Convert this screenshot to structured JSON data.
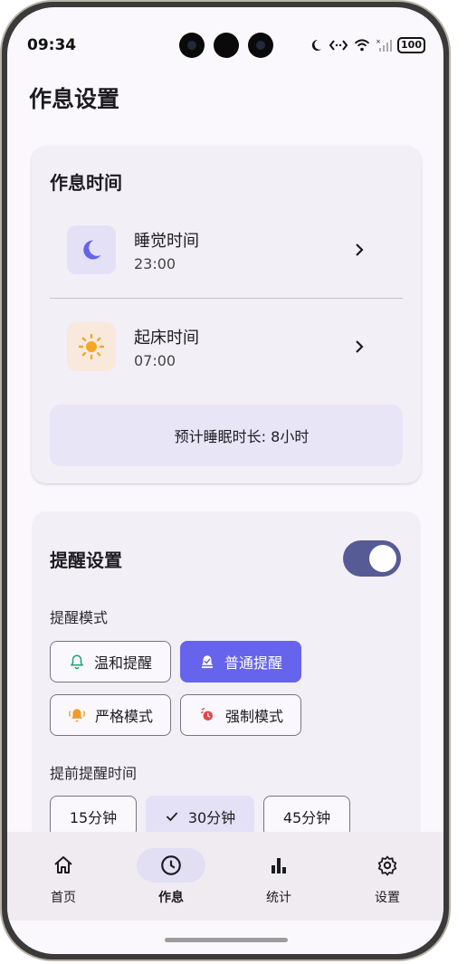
{
  "status_bar": {
    "time": "09:34",
    "battery": "100"
  },
  "page": {
    "title": "作息设置"
  },
  "schedule": {
    "title": "作息时间",
    "sleep": {
      "label": "睡觉时间",
      "value": "23:00"
    },
    "wake": {
      "label": "起床时间",
      "value": "07:00"
    },
    "summary": "预计睡眠时长: 8小时"
  },
  "reminder": {
    "title": "提醒设置",
    "enabled": true,
    "mode_label": "提醒模式",
    "modes": [
      {
        "label": "温和提醒",
        "selected": false
      },
      {
        "label": "普通提醒",
        "selected": true
      },
      {
        "label": "严格模式",
        "selected": false
      },
      {
        "label": "强制模式",
        "selected": false
      }
    ],
    "advance_label": "提前提醒时间",
    "advance_options": [
      {
        "label": "15分钟",
        "selected": false
      },
      {
        "label": "30分钟",
        "selected": true
      },
      {
        "label": "45分钟",
        "selected": false
      }
    ]
  },
  "nav": {
    "items": [
      {
        "label": "首页",
        "icon": "home-icon"
      },
      {
        "label": "作息",
        "icon": "clock-icon",
        "active": true
      },
      {
        "label": "统计",
        "icon": "bar-chart-icon"
      },
      {
        "label": "设置",
        "icon": "gear-icon"
      }
    ]
  },
  "colors": {
    "accent": "#6664ec",
    "toggle": "#565a95",
    "sun": "#f5a623",
    "bell_green": "#1aa36f",
    "bell_orange": "#f09a2a",
    "alarm_red": "#e04848"
  }
}
